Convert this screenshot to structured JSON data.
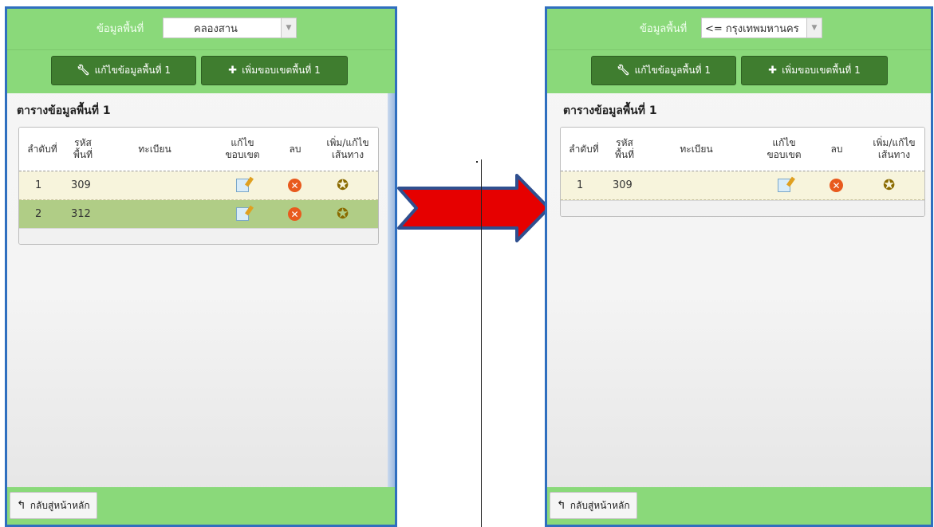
{
  "before": {
    "area_label": "ข้อมูลพื้นที่",
    "area_value": "คลองสาน",
    "btn_edit": "แก้ไขข้อมูลพื้นที่ 1",
    "btn_add": "เพิ่มขอบเขตพื้นที่ 1",
    "table_title": "ตารางข้อมูลพื้นที่ 1",
    "headers": {
      "order": "ลำดับที่",
      "code": "รหัส พื้นที่",
      "reg": "ทะเบียน",
      "edit_bound": "แก้ไข ขอบเขต",
      "del": "ลบ",
      "route": "เพิ่ม/แก้ไข เส้นทาง"
    },
    "rows": [
      {
        "no": "1",
        "code": "309"
      },
      {
        "no": "2",
        "code": "312"
      }
    ],
    "back": "กลับสู่หน้าหลัก"
  },
  "after": {
    "area_label": "ข้อมูลพื้นที่",
    "area_value": "<= กรุงเทพมหานคร",
    "btn_edit": "แก้ไขข้อมูลพื้นที่ 1",
    "btn_add": "เพิ่มขอบเขตพื้นที่ 1",
    "table_title": "ตารางข้อมูลพื้นที่ 1",
    "headers": {
      "order": "ลำดับที่",
      "code": "รหัส พื้นที่",
      "reg": "ทะเบียน",
      "edit_bound": "แก้ไข ขอบเขต",
      "del": "ลบ",
      "route": "เพิ่ม/แก้ไข เส้นทาง"
    },
    "rows": [
      {
        "no": "1",
        "code": "309"
      }
    ],
    "back": "กลับสู่หน้าหลัก"
  },
  "icons": {
    "edit": "pencil-paper-icon",
    "add": "plus-icon",
    "wrench": "wrench-icon",
    "delete": "delete-x-icon",
    "route": "route-pin-icon",
    "back": "back-arrow-icon",
    "transition": "right-arrow-icon"
  },
  "colors": {
    "header_green": "#8ad97a",
    "button_green": "#3f7d2f",
    "panel_border": "#2f6fbf",
    "arrow_red": "#e60000",
    "selected_row": "#b0cd86",
    "odd_row": "#f7f4dc"
  }
}
